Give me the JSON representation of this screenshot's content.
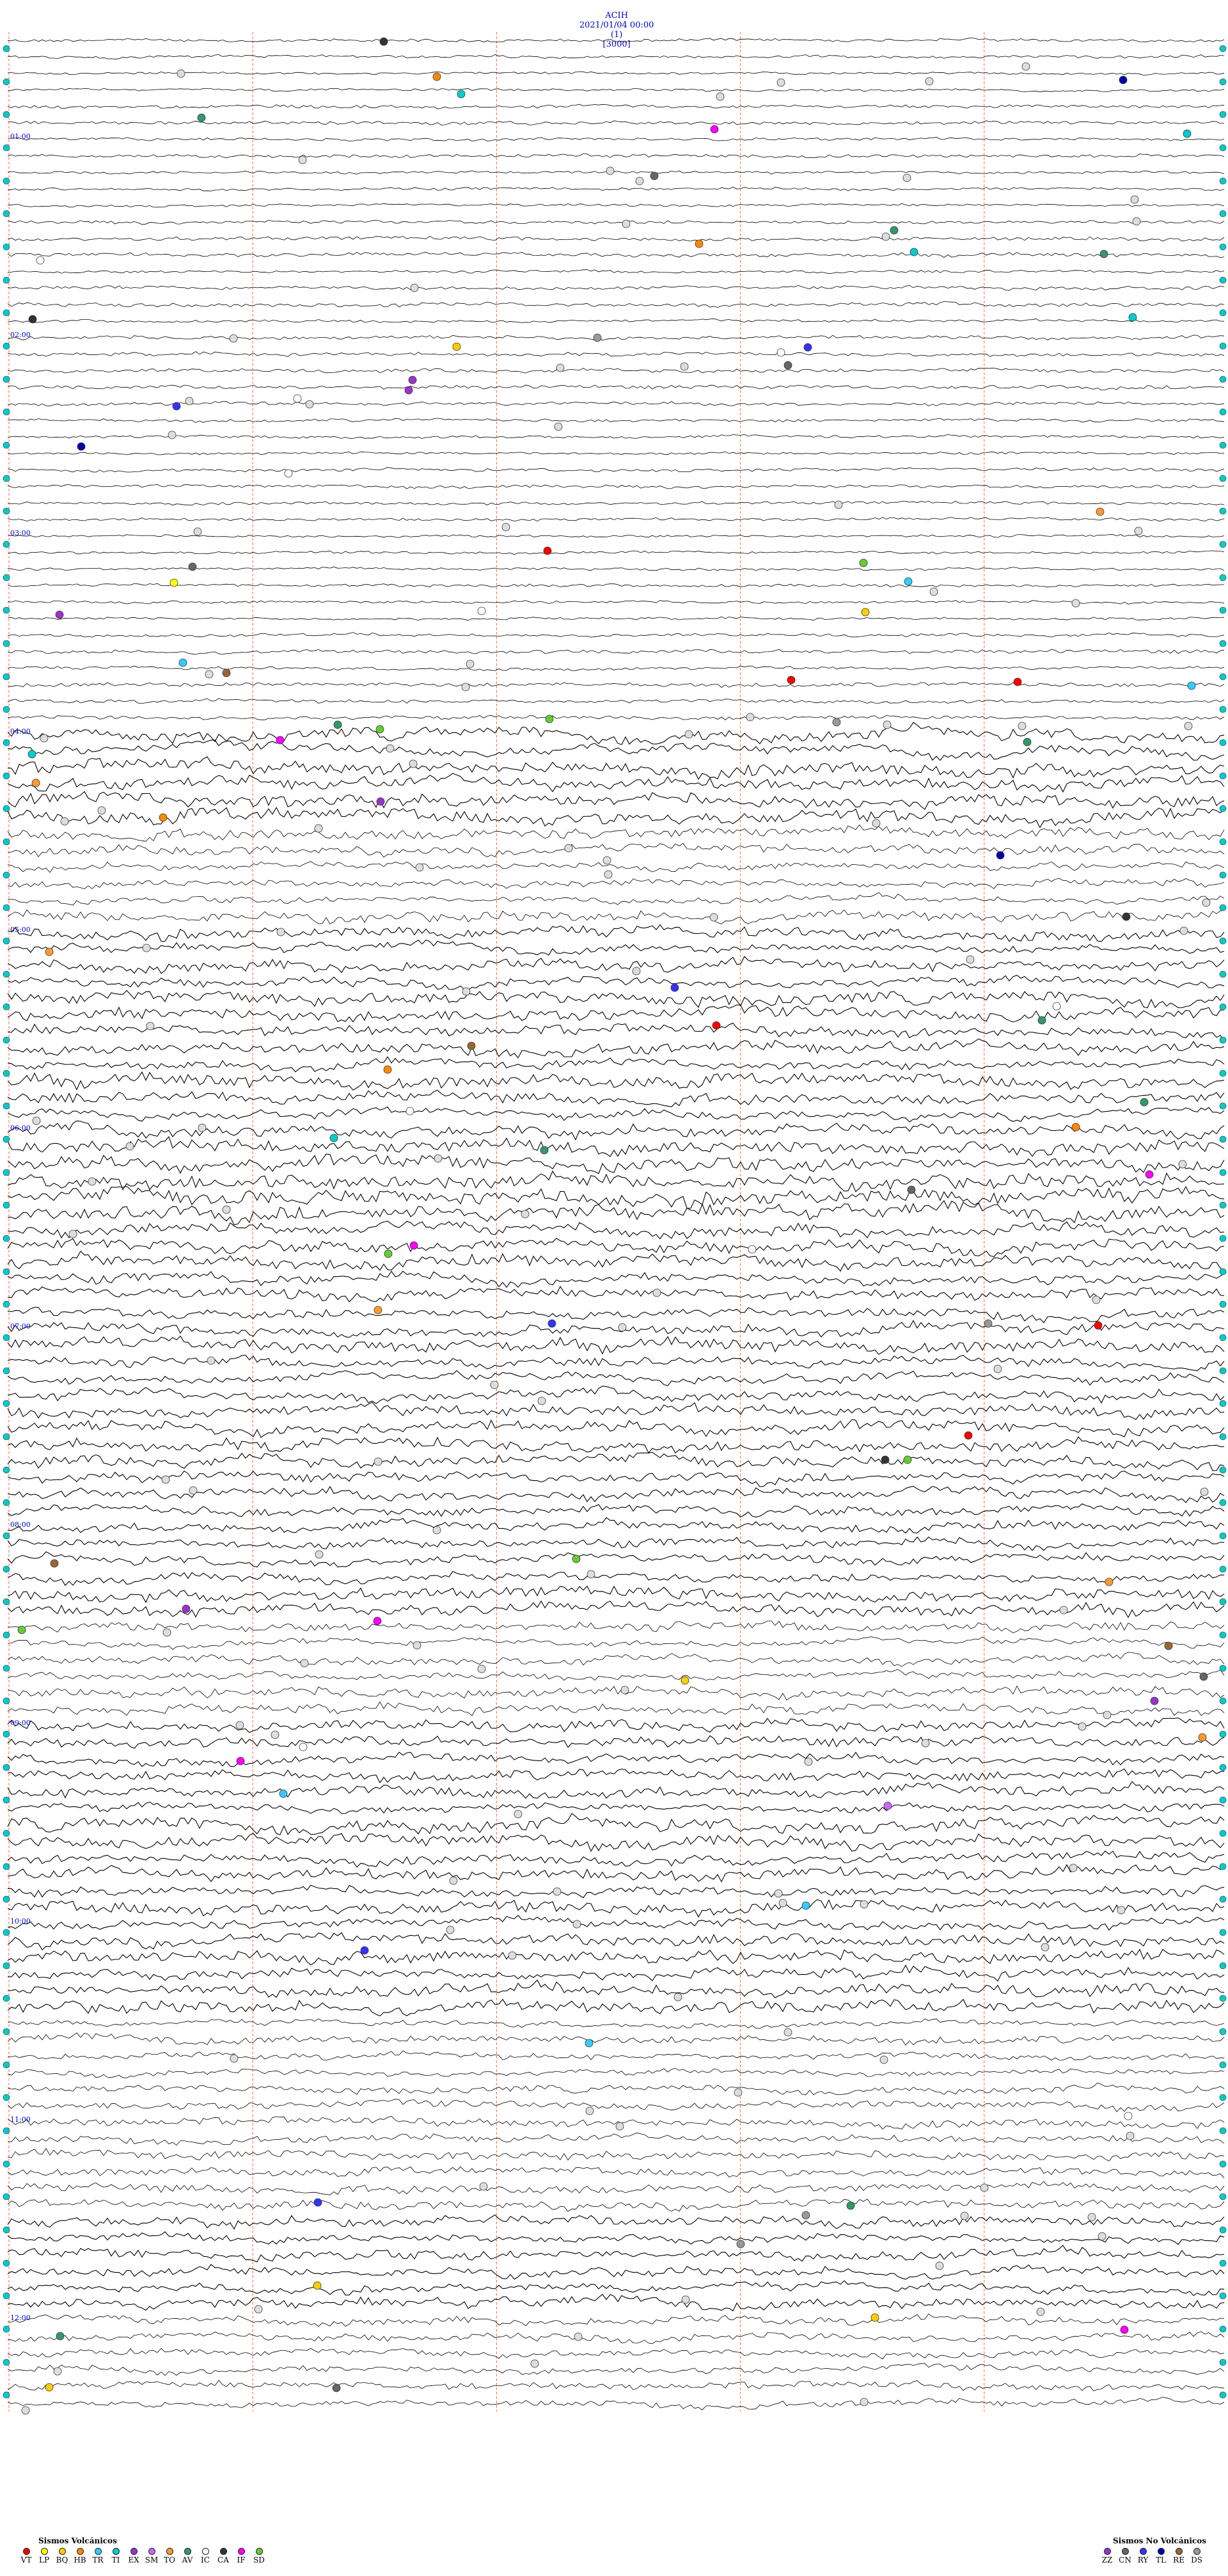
{
  "header": {
    "station": "ACIH",
    "datetime": "2021/01/04 00:00",
    "channel": "(1)",
    "scale": "[3000]"
  },
  "chart_data": {
    "type": "helicorder",
    "title": "ACIH 2021/01/04 00:00 (1) [3000]",
    "traces": 24,
    "time_labels": [
      "",
      "01:00",
      "",
      "02:00",
      "",
      "03:00",
      "",
      "04:00",
      "",
      "05:00",
      "",
      "06:00",
      "",
      "07:00",
      "",
      "08:00",
      "",
      "09:00",
      "",
      "10:00",
      "",
      "11:00",
      "",
      "12:00"
    ],
    "minute_markers": 5,
    "activity_levels": [
      0.15,
      0.15,
      0.2,
      0.2,
      0.15,
      0.15,
      0.2,
      0.9,
      0.6,
      0.7,
      0.75,
      0.85,
      0.85,
      0.75,
      0.8,
      0.7,
      0.6,
      0.65,
      0.75,
      0.7,
      0.45,
      0.5,
      0.7,
      0.55
    ],
    "grid": true,
    "legend_placement": "bottom"
  },
  "legend": {
    "volcanic_title": "Sismos Volcánicos",
    "volcanic": [
      {
        "code": "VT",
        "color": "#ff0000"
      },
      {
        "code": "LP",
        "color": "#ffff00"
      },
      {
        "code": "BQ",
        "color": "#ffcc00"
      },
      {
        "code": "HB",
        "color": "#ff8800"
      },
      {
        "code": "TR",
        "color": "#33ccff"
      },
      {
        "code": "TI",
        "color": "#00cccc"
      },
      {
        "code": "EX",
        "color": "#9933cc"
      },
      {
        "code": "SM",
        "color": "#cc66ff"
      },
      {
        "code": "TO",
        "color": "#ff9933"
      },
      {
        "code": "AV",
        "color": "#339966"
      },
      {
        "code": "IC",
        "color": "#ffffff"
      },
      {
        "code": "CA",
        "color": "#333333"
      },
      {
        "code": "IF",
        "color": "#ff00ff"
      },
      {
        "code": "SD",
        "color": "#66cc33"
      }
    ],
    "nonvolcanic_title": "Sismos No Volcánicos",
    "nonvolcanic": [
      {
        "code": "ZZ",
        "color": "#9933cc"
      },
      {
        "code": "CN",
        "color": "#666666"
      },
      {
        "code": "RY",
        "color": "#3333ff"
      },
      {
        "code": "TL",
        "color": "#0000aa"
      },
      {
        "code": "RE",
        "color": "#996633"
      },
      {
        "code": "DS",
        "color": "#999999"
      }
    ]
  },
  "colors": {
    "trace": "#000000",
    "time_label": "#0000cc",
    "marker_line": "#ff6633",
    "ti_marker": "#00cccc",
    "background": "#ffffff"
  }
}
